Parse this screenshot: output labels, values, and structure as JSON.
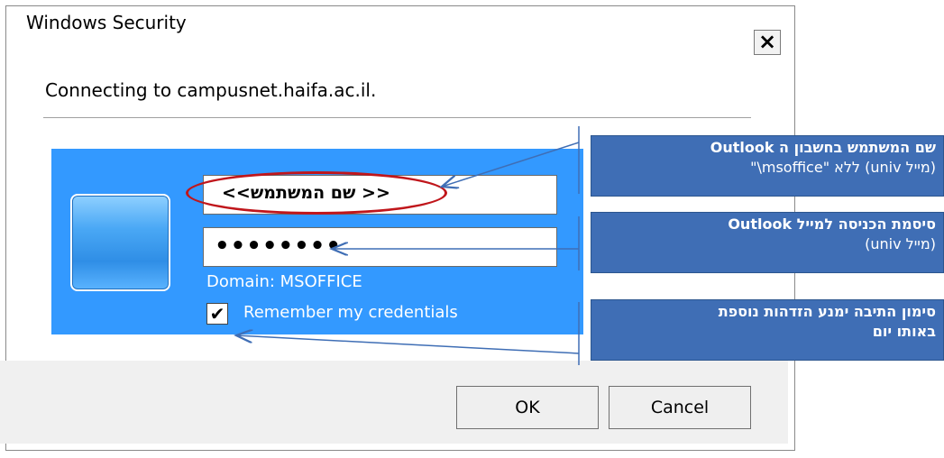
{
  "window": {
    "title": "Windows Security",
    "close_glyph": "×"
  },
  "dialog": {
    "connecting_text": "Connecting to campusnet.haifa.ac.il.",
    "username_value": "<< שם המשתמש>>",
    "password_value": "••••••••",
    "domain_text": "Domain: MSOFFICE",
    "remember_label": "Remember my credentials",
    "remember_checked": true,
    "ok_label": "OK",
    "cancel_label": "Cancel"
  },
  "annotations": [
    {
      "line1": "שם המשתמש בחשבון ה Outlook",
      "line2": "(מייל univ) ללא \"msoffice\\\""
    },
    {
      "line1": "סיסמת הכניסה למייל Outlook",
      "line2": "(מייל univ)"
    },
    {
      "line1": "סימון התיבה ימנע הזדהות נוספת",
      "line2": "באותו יום"
    }
  ],
  "colors": {
    "panel": "#3399ff",
    "annotation": "#3f6eb5",
    "highlight": "#c0161b"
  },
  "icons": [
    "close-icon",
    "user-avatar-icon",
    "checkbox-check-icon"
  ]
}
